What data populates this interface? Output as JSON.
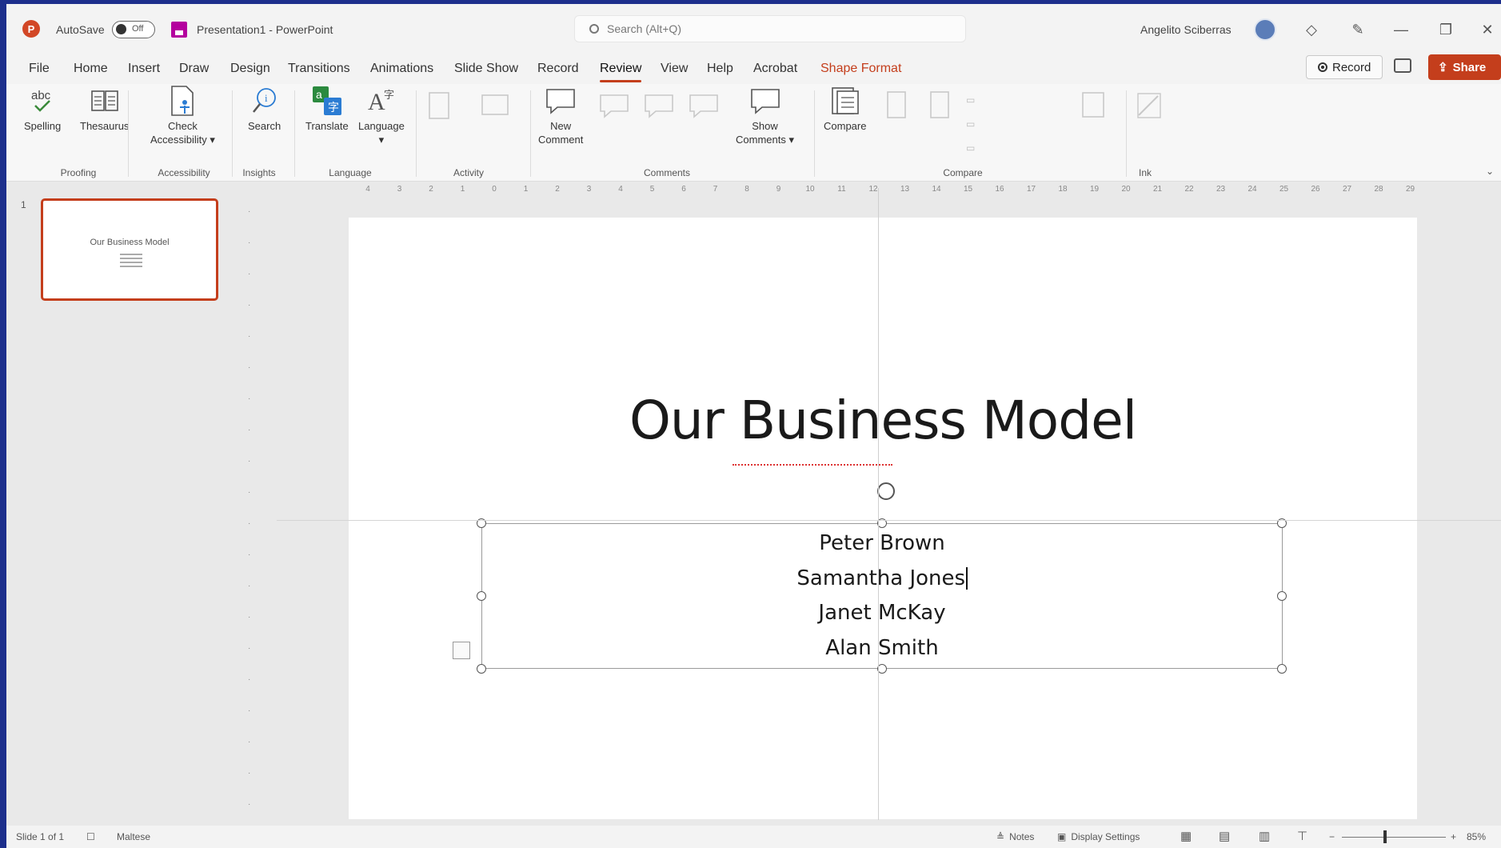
{
  "titlebar": {
    "logo": "P",
    "autosave_label": "AutoSave",
    "autosave_state": "Off",
    "doc_title": "Presentation1 - PowerPoint",
    "search_placeholder": "Search (Alt+Q)",
    "user_name": "Angelito Sciberras"
  },
  "menu": {
    "tabs": [
      "File",
      "Home",
      "Insert",
      "Draw",
      "Design",
      "Transitions",
      "Animations",
      "Slide Show",
      "Record",
      "Review",
      "View",
      "Help",
      "Acrobat",
      "Shape Format"
    ],
    "active_tab": "Review",
    "contextual_tab": "Shape Format",
    "record_label": "Record",
    "share_label": "Share"
  },
  "ribbon": {
    "buttons": {
      "spelling": "Spelling",
      "thesaurus": "Thesaurus",
      "check_accessibility_1": "Check",
      "check_accessibility_2": "Accessibility ▾",
      "search": "Search",
      "translate": "Translate",
      "language": "Language",
      "language_arrow": "▾",
      "new_comment_1": "New",
      "new_comment_2": "Comment",
      "show_comments_1": "Show",
      "show_comments_2": "Comments ▾",
      "compare": "Compare"
    },
    "groups": [
      "Proofing",
      "Accessibility",
      "Insights",
      "Language",
      "Activity",
      "Comments",
      "Compare",
      "Ink"
    ]
  },
  "slide_panel": {
    "slide_number": "1",
    "thumb_title": "Our Business Model"
  },
  "slide": {
    "title": "Our Business Model",
    "names": [
      "Peter Brown",
      "Samantha Jones",
      "Janet McKay",
      "Alan Smith"
    ]
  },
  "ruler": {
    "h_ticks": [
      "4",
      "3",
      "2",
      "1",
      "0",
      "1",
      "2",
      "3",
      "4",
      "5",
      "6",
      "7",
      "8",
      "9",
      "10",
      "11",
      "12",
      "13",
      "14",
      "15",
      "16",
      "17",
      "18",
      "19",
      "20",
      "21",
      "22",
      "23",
      "24",
      "25",
      "26",
      "27",
      "28",
      "29"
    ]
  },
  "statusbar": {
    "slide_count": "Slide 1 of 1",
    "language": "Maltese",
    "notes": "Notes",
    "display_settings": "Display Settings",
    "zoom": "85%"
  },
  "colors": {
    "accent": "#c43e1c",
    "background_frame": "#1d2f8c"
  }
}
